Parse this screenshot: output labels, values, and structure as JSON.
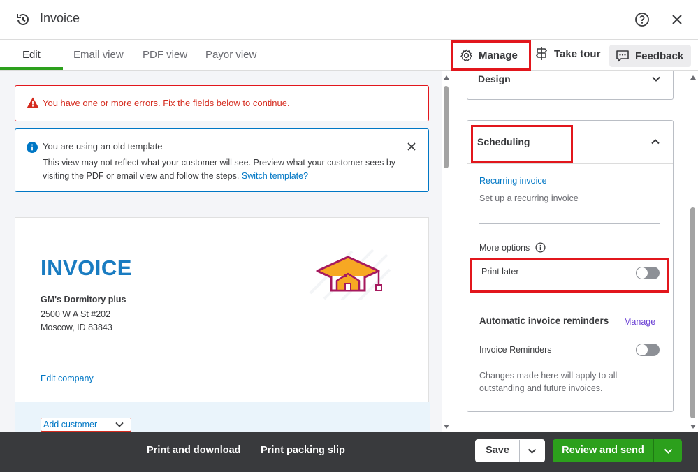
{
  "header": {
    "title": "Invoice",
    "history_icon": "history-icon",
    "help_icon": "help-icon",
    "close_icon": "close-icon"
  },
  "tabs": [
    {
      "label": "Edit",
      "active": true
    },
    {
      "label": "Email view",
      "active": false
    },
    {
      "label": "PDF view",
      "active": false
    },
    {
      "label": "Payor view",
      "active": false
    }
  ],
  "toolbar": {
    "manage_label": "Manage",
    "tour_label": "Take tour",
    "feedback_label": "Feedback"
  },
  "alerts": {
    "error_text": "You have one or more errors. Fix the fields below to continue.",
    "info_title": "You are using an old template",
    "info_body": "This view may not reflect what your customer will see. Preview what your customer sees by visiting the PDF or email view and follow the steps.",
    "info_link": "Switch template?"
  },
  "invoice": {
    "heading": "INVOICE",
    "company_name": "GM's Dormitory plus",
    "address_line1": "2500 W A St #202",
    "address_line2": "Moscow, ID 83843",
    "edit_company": "Edit company",
    "add_customer": "Add customer"
  },
  "sidebar": {
    "design_label": "Design",
    "scheduling_label": "Scheduling",
    "recurring_link": "Recurring invoice",
    "recurring_sub": "Set up a recurring invoice",
    "more_options": "More options",
    "print_later": "Print later",
    "print_later_on": false,
    "auto_reminders": "Automatic invoice reminders",
    "auto_manage": "Manage",
    "invoice_reminders": "Invoice Reminders",
    "invoice_reminders_on": false,
    "reminders_note": "Changes made here will apply to all outstanding and future invoices."
  },
  "footer": {
    "print_download": "Print and download",
    "print_packing": "Print packing slip",
    "save": "Save",
    "review_send": "Review and send"
  },
  "colors": {
    "accent_green": "#2ca01c",
    "error_red": "#e2161c",
    "link_blue": "#0077c5",
    "invoice_blue": "#1a7cc1",
    "footer_bg": "#393a3d"
  }
}
